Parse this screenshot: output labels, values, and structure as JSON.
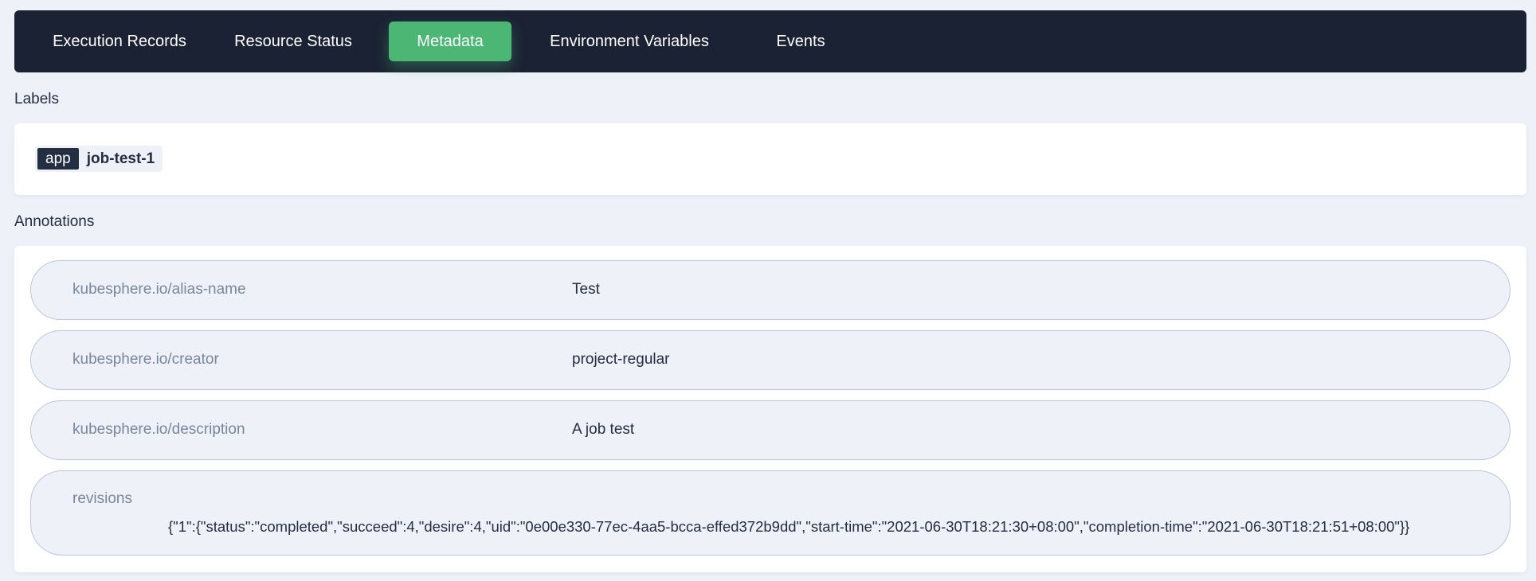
{
  "tabs": [
    {
      "label": "Execution Records",
      "active": false
    },
    {
      "label": "Resource Status",
      "active": false
    },
    {
      "label": "Metadata",
      "active": true
    },
    {
      "label": "Environment Variables",
      "active": false
    },
    {
      "label": "Events",
      "active": false
    }
  ],
  "labels_section": {
    "title": "Labels",
    "items": [
      {
        "key": "app",
        "value": "job-test-1"
      }
    ]
  },
  "annotations_section": {
    "title": "Annotations",
    "items": [
      {
        "key": "kubesphere.io/alias-name",
        "value": "Test"
      },
      {
        "key": "kubesphere.io/creator",
        "value": "project-regular"
      },
      {
        "key": "kubesphere.io/description",
        "value": "A job test"
      },
      {
        "key": "revisions",
        "value": "{\"1\":{\"status\":\"completed\",\"succeed\":4,\"desire\":4,\"uid\":\"0e00e330-77ec-4aa5-bcca-effed372b9dd\",\"start-time\":\"2021-06-30T18:21:30+08:00\",\"completion-time\":\"2021-06-30T18:21:51+08:00\"}}"
      }
    ]
  },
  "colors": {
    "tabbar_bg": "#1b2233",
    "active_tab": "#4cb775",
    "page_bg": "#eef2f8",
    "label_key_bg": "#242e42"
  }
}
